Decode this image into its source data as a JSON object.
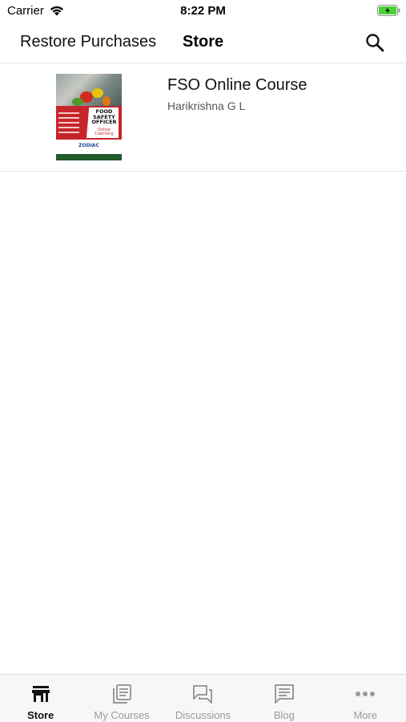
{
  "status_bar": {
    "carrier": "Carrier",
    "time": "8:22 PM"
  },
  "nav": {
    "restore_label": "Restore Purchases",
    "title": "Store"
  },
  "courses": [
    {
      "title": "FSO Online Course",
      "author": "Harikrishna G L",
      "thumbnail": {
        "headline": "FOOD SAFETY OFFICER",
        "subline": "Online Coaching",
        "logo": "ZODIAC"
      }
    }
  ],
  "tabs": [
    {
      "label": "Store",
      "icon": "store-icon",
      "active": true
    },
    {
      "label": "My Courses",
      "icon": "my-courses-icon",
      "active": false
    },
    {
      "label": "Discussions",
      "icon": "discussions-icon",
      "active": false
    },
    {
      "label": "Blog",
      "icon": "blog-icon",
      "active": false
    },
    {
      "label": "More",
      "icon": "more-icon",
      "active": false
    }
  ],
  "colors": {
    "active_tab": "#111111",
    "inactive_tab": "#9a9a9a",
    "battery": "#4cd137"
  }
}
